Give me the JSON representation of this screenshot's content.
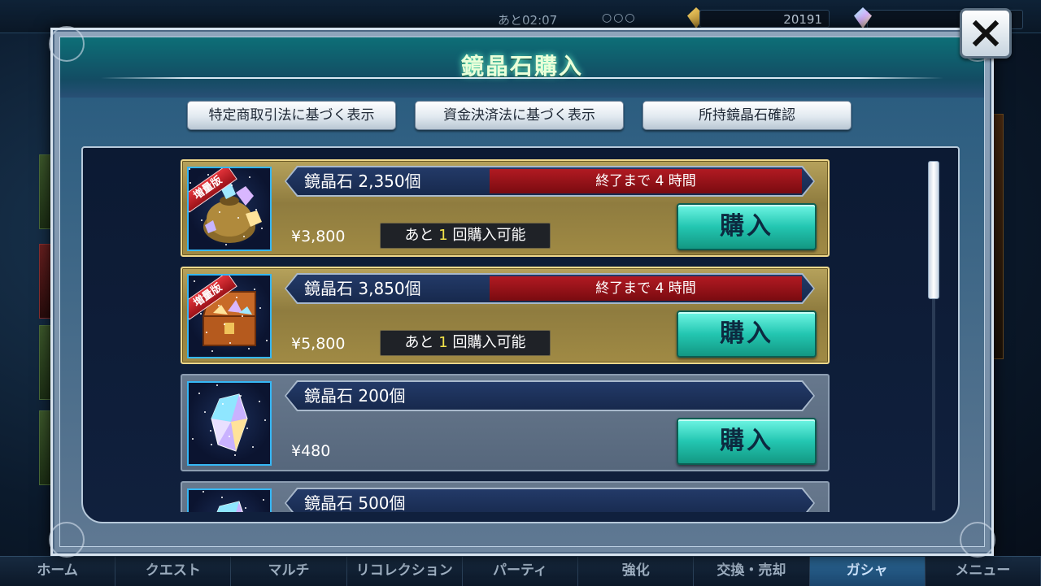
{
  "topbar": {
    "timer": "あと02:07",
    "dots": "○○○",
    "coins": "20191"
  },
  "dialog": {
    "title": "鏡晶石購入",
    "buttons": [
      "特定商取引法に基づく表示",
      "資金決済法に基づく表示",
      "所持鏡晶石確認"
    ]
  },
  "items": [
    {
      "name": "鏡晶石 2,350個",
      "timer": "終了まで 4 時間",
      "price": "¥3,800",
      "limit_prefix": "あと",
      "limit_count": "1",
      "limit_suffix": "回購入可能",
      "badge": "増量版",
      "buy": "購入"
    },
    {
      "name": "鏡晶石 3,850個",
      "timer": "終了まで 4 時間",
      "price": "¥5,800",
      "limit_prefix": "あと",
      "limit_count": "1",
      "limit_suffix": "回購入可能",
      "badge": "増量版",
      "buy": "購入"
    },
    {
      "name": "鏡晶石 200個",
      "price": "¥480",
      "buy": "購入"
    },
    {
      "name": "鏡晶石 500個"
    }
  ],
  "bottom_nav": [
    "ホーム",
    "クエスト",
    "マルチ",
    "リコレクション",
    "パーティ",
    "強化",
    "交換・売却",
    "ガシャ",
    "メニュー"
  ],
  "active_nav": "ガシャ",
  "icons": {
    "close": "close-icon",
    "bag": "crystal-bag-icon",
    "chest": "treasure-chest-icon",
    "crystal": "crystal-icon"
  }
}
